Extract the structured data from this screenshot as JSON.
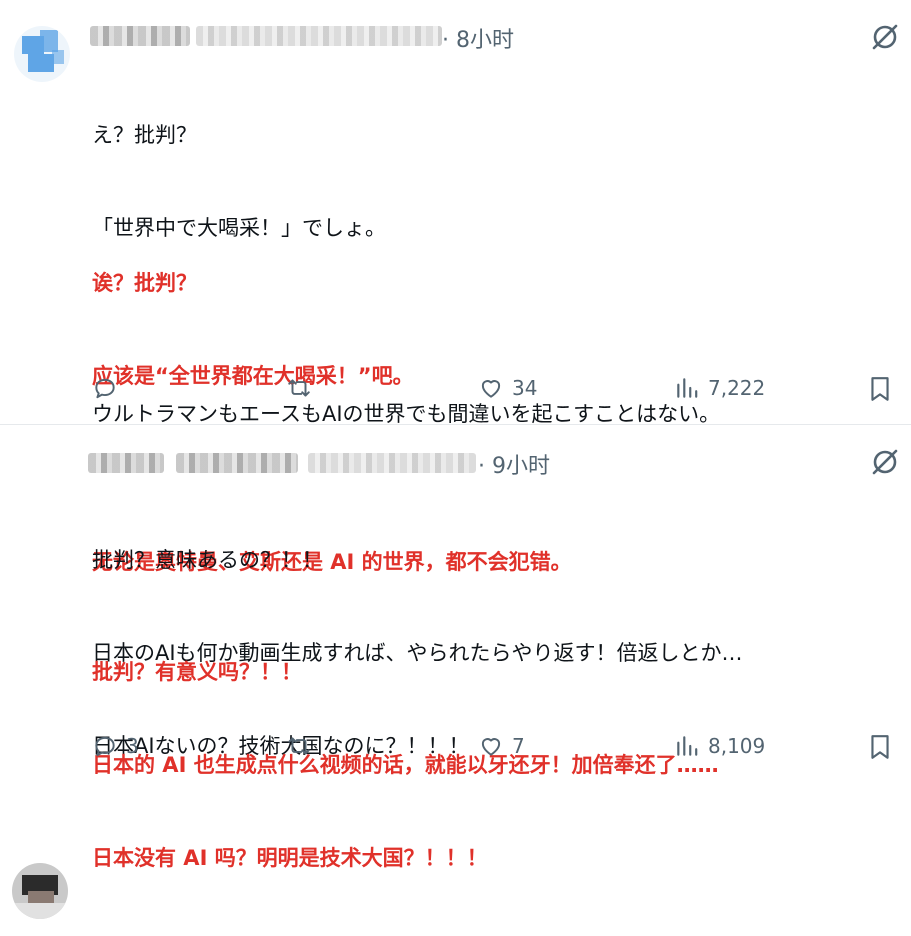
{
  "posts": [
    {
      "time": "· 8小时",
      "lines": [
        "え？批判？",
        "「世界中で大喝采！」でしょ。",
        "",
        "ウルトラマンもエースもAIの世界でも間違いを起こすことはない。"
      ],
      "translation": [
        "诶？批判？",
        "应该是“全世界都在大喝采！”吧。",
        "",
        "无论是奥特曼、艾斯还是 AI 的世界，都不会犯错。"
      ],
      "actions": {
        "reply": "",
        "repost": "",
        "like": "34",
        "views": "7,222"
      }
    },
    {
      "time": "· 9小时",
      "lines": [
        "批判？意味あるの？！！",
        "日本のAIも何か動画生成すれば、やられたらやり返す！倍返しとか…",
        "日本AIないの？技術大国なのに？！！！"
      ],
      "translation": [
        "批判？有意义吗？！！",
        "日本的 AI 也生成点什么视频的话，就能以牙还牙！加倍奉还了……",
        "日本没有 AI 吗？明明是技术大国？！！！"
      ],
      "actions": {
        "reply": "3",
        "repost": "",
        "like": "7",
        "views": "8,109"
      }
    }
  ],
  "icons": {
    "reply": "reply-icon",
    "repost": "repost-icon",
    "like": "like-icon",
    "views": "views-icon",
    "bookmark": "bookmark-icon",
    "grok": "grok-icon"
  },
  "colors": {
    "text": "#0f1419",
    "muted": "#536471",
    "translation": "#e0312a",
    "divider": "#e6e9ec"
  }
}
